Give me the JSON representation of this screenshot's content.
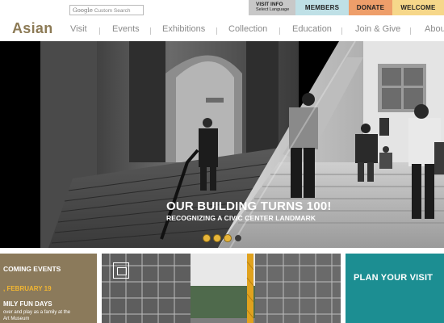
{
  "search": {
    "brand": "Google",
    "placeholder": "Custom Search"
  },
  "utility": {
    "visit_info": {
      "line1": "VISIT INFO",
      "line2": "Select Language"
    },
    "members": "MEMBERS",
    "donate": "DONATE",
    "welcome": "WELCOME",
    "colors": {
      "visit_info": "#c8c8c8",
      "members": "#bfe0e6",
      "donate": "#ee9e6a",
      "welcome": "#f6d78a"
    }
  },
  "logo": {
    "text": "Asian",
    "color": "#8c7a55"
  },
  "nav": {
    "items": [
      {
        "label": "Visit"
      },
      {
        "label": "Events"
      },
      {
        "label": "Exhibitions"
      },
      {
        "label": "Collection"
      },
      {
        "label": "Education"
      },
      {
        "label": "Join & Give"
      },
      {
        "label": "About"
      }
    ]
  },
  "hero": {
    "title": "OUR BUILDING TURNS 100!",
    "subtitle": "RECOGNIZING A CIVIC CENTER LANDMARK",
    "slides": {
      "count": 4,
      "active": 4
    }
  },
  "cards": {
    "events": {
      "heading": "COMING EVENTS",
      "date": ", FEBRUARY 19",
      "name": "MILY FUN DAYS",
      "desc_line1": "over and play as a family at the",
      "desc_line2": "Art Museum",
      "bg_color": "#8b7a5b",
      "accent_color": "#f2b632"
    },
    "construction": {
      "icon": "photo-frame-icon"
    },
    "plan": {
      "text": "PLAN YOUR VISIT",
      "bg_color": "#1c8e92"
    }
  }
}
